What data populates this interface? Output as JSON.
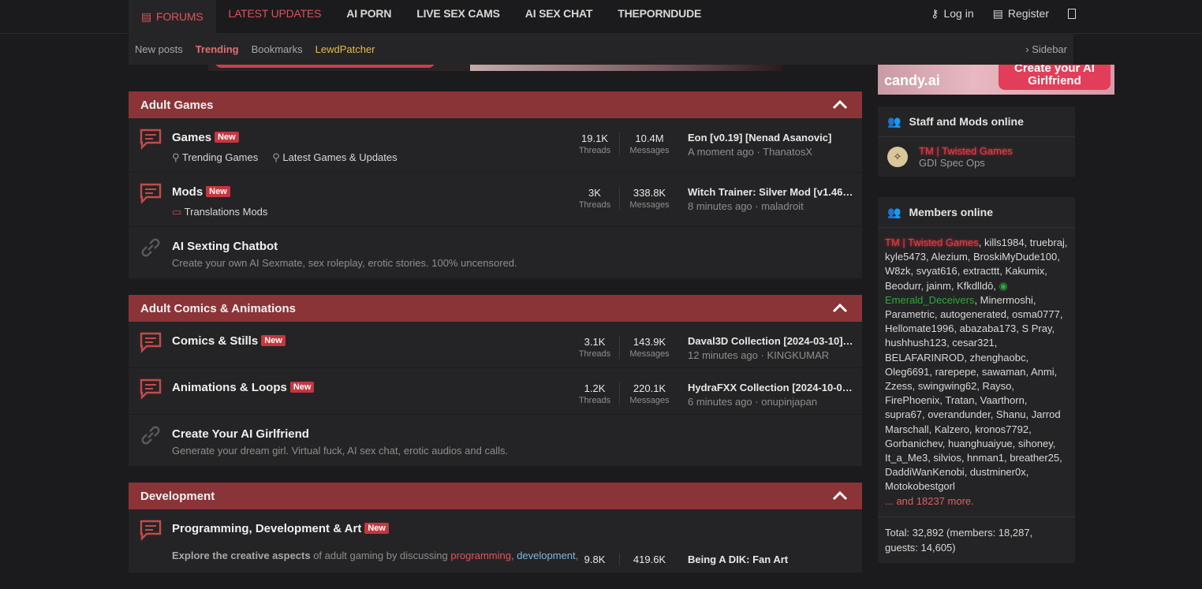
{
  "nav": {
    "tabs": [
      "FORUMS",
      "LATEST UPDATES",
      "AI PORN",
      "LIVE SEX CAMS",
      "AI SEX CHAT",
      "THEPORNDUDE"
    ],
    "login": "Log in",
    "register": "Register"
  },
  "subnav": {
    "new_posts": "New posts",
    "trending": "Trending",
    "bookmarks": "Bookmarks",
    "lewdpatcher": "LewdPatcher",
    "sidebar": "Sidebar"
  },
  "banner": {
    "logo": "candy.ai",
    "cta": "Create your AI Girlfriend"
  },
  "colors": {
    "accent": "#8b3438",
    "badge": "#c7363f",
    "staff": "#e83846",
    "green": "#2fa83a"
  },
  "blocks": [
    {
      "title": "Adult Games",
      "nodes": [
        {
          "title": "Games",
          "badge": "New",
          "subs": [
            "Trending Games",
            "Latest Games & Updates"
          ],
          "threads": "19.1K",
          "messages": "10.4M",
          "latest_title": "Eon [v0.19] [Nenad Asanovic]",
          "latest_meta": "A moment ago · ThanatosX"
        },
        {
          "title": "Mods",
          "badge": "New",
          "subs": [
            "Translations Mods"
          ],
          "threads": "3K",
          "messages": "338.8K",
          "latest_title": "Witch Trainer: Silver Mod [v1.46.1...",
          "latest_meta": "8 minutes ago · maladroit"
        },
        {
          "title": "AI Sexting Chatbot",
          "desc": "Create your own AI Sexmate, sex roleplay, erotic stories. 100% uncensored."
        }
      ]
    },
    {
      "title": "Adult Comics & Animations",
      "nodes": [
        {
          "title": "Comics & Stills",
          "badge": "New",
          "threads": "3.1K",
          "messages": "143.9K",
          "latest_title": "Daval3D Collection [2024-03-10] [...",
          "latest_meta": "12 minutes ago · KINGKUMAR"
        },
        {
          "title": "Animations & Loops",
          "badge": "New",
          "threads": "1.2K",
          "messages": "220.1K",
          "latest_title": "HydraFXX Collection [2024-10-04...",
          "latest_meta": "6 minutes ago · onupinjapan"
        },
        {
          "title": "Create Your AI Girlfriend",
          "desc": "Generate your dream girl. Virtual fuck, AI sex chat, erotic audios and calls."
        }
      ]
    },
    {
      "title": "Development",
      "nodes": [
        {
          "title": "Programming, Development & Art",
          "badge": "New",
          "desc_lead": "Explore the creative aspects",
          "desc_rest": " of adult gaming by discussing ",
          "desc_link1": "programming",
          "desc_link2": "development",
          "threads": "9.8K",
          "messages": "419.6K",
          "latest_title": "Being A DIK: Fan Art"
        }
      ]
    }
  ],
  "labels": {
    "threads": "Threads",
    "messages": "Messages"
  },
  "sidebar": {
    "staff_title": "Staff and Mods online",
    "staff_name": "TM | Twisted Games",
    "staff_role": "GDI Spec Ops",
    "members_title": "Members online",
    "members_first": "TM | Twisted Games",
    "members_a": ", kills1984, truebraj, kyle5473, Alezium, BroskiMyDude100, W8zk, svyat616, extracttt, Kakumix, Beodurr, jainm, Kfkdlldō, ",
    "members_green": "Emerald_Deceivers",
    "members_b": ", Minermoshi, Parametric, autogenerated, osma0777, Hellomate1996, abazaba173, S Pray, hushhush123, cesar321, BELAFARINROD, zhenghaobc, Oleg6691, rarepepe, sawaman, Anmi, Zzess, swingwing62, Rayso, FirePhoenix, Tratan, Vaarthorn, supra67, overandunder, Shanu, Jarrod Marschall, Kalzero, kronos7792, Gorbanichev, huanghuaiyue, sihoney, It_a_Me3, silvios, hnman1, breather25, DaddiWanKenobi, dustminer0x, Motokobestgorl",
    "more": "... and 18237 more.",
    "total": "Total: 32,892 (members: 18,287, guests: 14,605)"
  }
}
